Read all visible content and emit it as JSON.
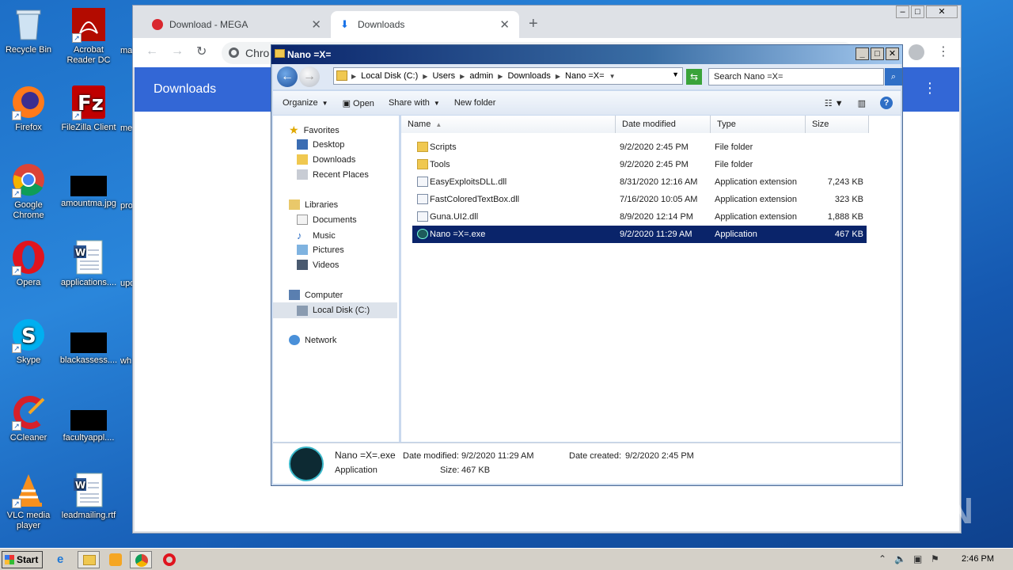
{
  "desktop": {
    "icons": [
      {
        "label": "Recycle Bin",
        "icon": "recycle-bin-icon"
      },
      {
        "label": "Acrobat Reader DC",
        "icon": "acrobat-icon"
      },
      {
        "label": "Firefox",
        "icon": "firefox-icon"
      },
      {
        "label": "FileZilla Client",
        "icon": "filezilla-icon"
      },
      {
        "label": "Google Chrome",
        "icon": "chrome-icon"
      },
      {
        "label": "amountma.jpg",
        "icon": "image-file-icon"
      },
      {
        "label": "Opera",
        "icon": "opera-icon"
      },
      {
        "label": "applications....",
        "icon": "word-doc-icon"
      },
      {
        "label": "Skype",
        "icon": "skype-icon"
      },
      {
        "label": "blackassess....",
        "icon": "image-file-icon"
      },
      {
        "label": "CCleaner",
        "icon": "ccleaner-icon"
      },
      {
        "label": "facultyappl....",
        "icon": "image-file-icon"
      },
      {
        "label": "VLC media player",
        "icon": "vlc-icon"
      },
      {
        "label": "leadmailing.rtf",
        "icon": "word-doc-icon"
      }
    ],
    "clipped_labels": [
      "ma",
      "me",
      "pro",
      "upo",
      "wh"
    ]
  },
  "browser": {
    "tabs": [
      {
        "label": "Download - MEGA",
        "icon": "mega-icon"
      },
      {
        "label": "Downloads",
        "icon": "download-icon"
      }
    ],
    "omnibox_text": "Chro",
    "page_title": "Downloads"
  },
  "explorer": {
    "title": "Nano =X=",
    "address_crumbs": [
      "Local Disk (C:)",
      "Users",
      "admin",
      "Downloads",
      "Nano =X="
    ],
    "search_placeholder": "Search Nano =X=",
    "commands": {
      "organize": "Organize",
      "open": "Open",
      "share": "Share with",
      "new_folder": "New folder"
    },
    "nav": {
      "favorites": "Favorites",
      "desktop": "Desktop",
      "downloads": "Downloads",
      "recent": "Recent Places",
      "libraries": "Libraries",
      "documents": "Documents",
      "music": "Music",
      "pictures": "Pictures",
      "videos": "Videos",
      "computer": "Computer",
      "local_disk": "Local Disk (C:)",
      "network": "Network"
    },
    "columns": {
      "name": "Name",
      "date": "Date modified",
      "type": "Type",
      "size": "Size"
    },
    "files": [
      {
        "name": "Scripts",
        "date": "9/2/2020 2:45 PM",
        "type": "File folder",
        "size": ""
      },
      {
        "name": "Tools",
        "date": "9/2/2020 2:45 PM",
        "type": "File folder",
        "size": ""
      },
      {
        "name": "EasyExploitsDLL.dll",
        "date": "8/31/2020 12:16 AM",
        "type": "Application extension",
        "size": "7,243 KB"
      },
      {
        "name": "FastColoredTextBox.dll",
        "date": "7/16/2020 10:05 AM",
        "type": "Application extension",
        "size": "323 KB"
      },
      {
        "name": "Guna.UI2.dll",
        "date": "8/9/2020 12:14 PM",
        "type": "Application extension",
        "size": "1,888 KB"
      },
      {
        "name": "Nano =X=.exe",
        "date": "9/2/2020 11:29 AM",
        "type": "Application",
        "size": "467 KB"
      }
    ],
    "details": {
      "name": "Nano =X=.exe",
      "modified_label": "Date modified:",
      "modified": "9/2/2020 11:29 AM",
      "created_label": "Date created:",
      "created": "9/2/2020 2:45 PM",
      "type": "Application",
      "size_label": "Size:",
      "size": "467 KB"
    }
  },
  "taskbar": {
    "start": "Start",
    "clock": "2:46 PM"
  },
  "watermark": "ANY RUN"
}
